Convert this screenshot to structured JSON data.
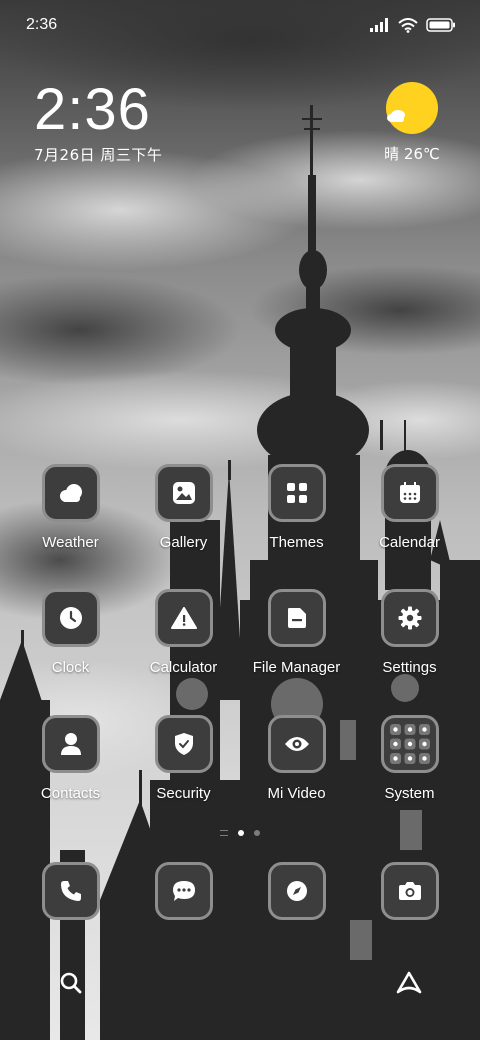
{
  "status_bar": {
    "time": "2:36"
  },
  "clock_widget": {
    "time": "2:36",
    "date": "7月26日 周三下午"
  },
  "weather_widget": {
    "condition_temp": "晴 26℃",
    "icon": "sunny-cloud-icon",
    "sun_color": "#ffd21f"
  },
  "apps": [
    {
      "label": "Weather",
      "icon": "weather-icon"
    },
    {
      "label": "Gallery",
      "icon": "gallery-icon"
    },
    {
      "label": "Themes",
      "icon": "themes-icon"
    },
    {
      "label": "Calendar",
      "icon": "calendar-icon"
    },
    {
      "label": "Clock",
      "icon": "clock-icon"
    },
    {
      "label": "Calculator",
      "icon": "calculator-icon"
    },
    {
      "label": "File Manager",
      "icon": "file-manager-icon"
    },
    {
      "label": "Settings",
      "icon": "settings-icon"
    },
    {
      "label": "Contacts",
      "icon": "contacts-icon"
    },
    {
      "label": "Security",
      "icon": "security-icon"
    },
    {
      "label": "Mi Video",
      "icon": "mi-video-icon"
    },
    {
      "label": "System",
      "icon": "system-folder-icon"
    }
  ],
  "dock": [
    {
      "icon": "phone-icon"
    },
    {
      "icon": "messages-icon"
    },
    {
      "icon": "browser-icon"
    },
    {
      "icon": "camera-icon"
    }
  ],
  "bottom_bar": {
    "left_icon": "search-icon",
    "right_icon": "assistant-icon"
  },
  "pages": {
    "count": 2,
    "current": 1
  },
  "colors": {
    "icon_bg": "#3d3d3d",
    "icon_border": "#8e8e8e",
    "accent_sun": "#ffd21f"
  }
}
